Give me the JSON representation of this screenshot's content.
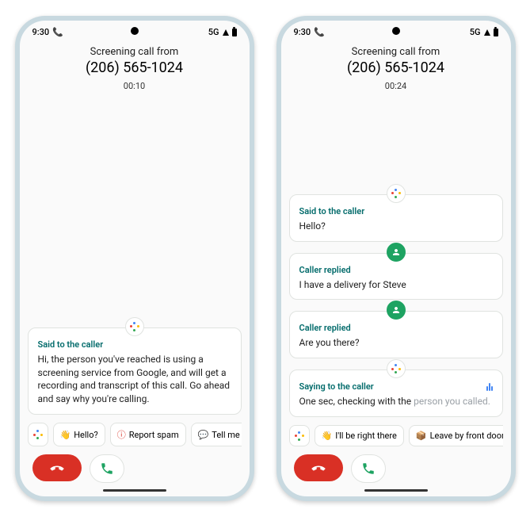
{
  "phones": [
    {
      "status": {
        "time": "9:30",
        "network": "5G"
      },
      "header": {
        "label": "Screening call from",
        "number": "(206) 565-1024",
        "duration": "00:10"
      },
      "cards": [
        {
          "badge": "assistant",
          "label": "Said to the caller",
          "text": "Hi, the person you've reached is using a screening service from Google, and will get a recording and transcript of this call. Go ahead and say why you're calling."
        }
      ],
      "chips": [
        {
          "icon": "assistant",
          "label": ""
        },
        {
          "icon": "wave",
          "label": "Hello?"
        },
        {
          "icon": "report",
          "label": "Report spam"
        },
        {
          "icon": "say",
          "label": "Tell me mo"
        }
      ]
    },
    {
      "status": {
        "time": "9:30",
        "network": "5G"
      },
      "header": {
        "label": "Screening call from",
        "number": "(206) 565-1024",
        "duration": "00:24"
      },
      "cards": [
        {
          "badge": "assistant",
          "label": "Said to the caller",
          "text": "Hello?"
        },
        {
          "badge": "person",
          "label": "Caller replied",
          "text": "I have a delivery for Steve"
        },
        {
          "badge": "person",
          "label": "Caller replied",
          "text": "Are you there?"
        },
        {
          "badge": "assistant",
          "label": "Saying to the caller",
          "live": true,
          "text": "One sec, checking with the ",
          "text_faded": "person you called."
        }
      ],
      "chips": [
        {
          "icon": "assistant",
          "label": ""
        },
        {
          "icon": "wave",
          "label": "I'll be right there"
        },
        {
          "icon": "box",
          "label": "Leave by front door"
        }
      ]
    }
  ]
}
